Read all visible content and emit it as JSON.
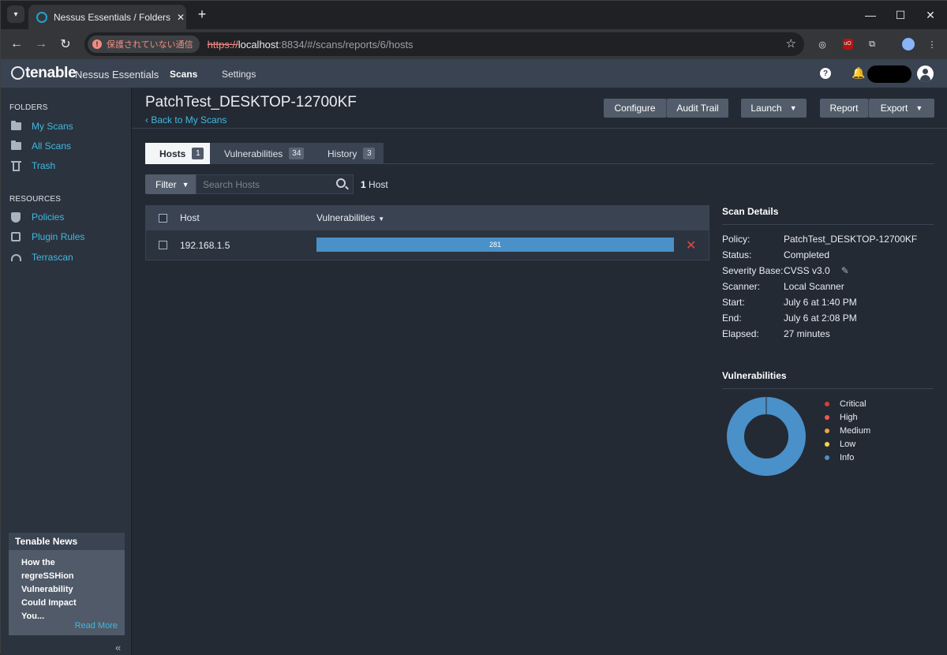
{
  "browser": {
    "tab_title": "Nessus Essentials / Folders / View Scan",
    "secure_label": "保護されていない通信",
    "url_scheme": "https://",
    "url_host": "localhost",
    "url_path": ":8834/#/scans/reports/6/hosts"
  },
  "app": {
    "logo": "tenable",
    "product": "Nessus Essentials",
    "nav_scans": "Scans",
    "nav_settings": "Settings"
  },
  "sidebar": {
    "folders_title": "FOLDERS",
    "folders": [
      {
        "label": "My Scans",
        "icon": "folder-icon"
      },
      {
        "label": "All Scans",
        "icon": "folder-icon"
      },
      {
        "label": "Trash",
        "icon": "trash-icon"
      }
    ],
    "resources_title": "RESOURCES",
    "resources": [
      {
        "label": "Policies",
        "icon": "shield-icon"
      },
      {
        "label": "Plugin Rules",
        "icon": "plugin-icon"
      },
      {
        "label": "Terrascan",
        "icon": "terrascan-icon"
      }
    ],
    "news_title": "Tenable News",
    "news_text": "How the regreSSHion Vulnerability Could Impact You...",
    "news_link": "Read More"
  },
  "main": {
    "title": "PatchTest_DESKTOP-12700KF",
    "back": "Back to My Scans",
    "buttons": {
      "configure": "Configure",
      "audit_trail": "Audit Trail",
      "launch": "Launch",
      "report": "Report",
      "export": "Export"
    },
    "tabs": [
      {
        "label": "Hosts",
        "count": "1"
      },
      {
        "label": "Vulnerabilities",
        "count": "34"
      },
      {
        "label": "History",
        "count": "3"
      }
    ],
    "filter_label": "Filter",
    "search_placeholder": "Search Hosts",
    "host_count_num": "1",
    "host_count_label": "Host",
    "table": {
      "col_host": "Host",
      "col_vulns": "Vulnerabilities",
      "rows": [
        {
          "host": "192.168.1.5",
          "vulns": "281",
          "info_fraction": 1.0
        }
      ]
    }
  },
  "scan_details": {
    "title": "Scan Details",
    "rows": [
      {
        "key": "Policy:",
        "value": "PatchTest_DESKTOP-12700KF"
      },
      {
        "key": "Status:",
        "value": "Completed"
      },
      {
        "key": "Severity Base:",
        "value": "CVSS v3.0"
      },
      {
        "key": "Scanner:",
        "value": "Local Scanner"
      },
      {
        "key": "Start:",
        "value": "July 6 at 1:40 PM"
      },
      {
        "key": "End:",
        "value": "July 6 at 2:08 PM"
      },
      {
        "key": "Elapsed:",
        "value": "27 minutes"
      }
    ]
  },
  "vulnerabilities": {
    "title": "Vulnerabilities",
    "legend": [
      {
        "label": "Critical",
        "color": "#d43f3a",
        "count": 0
      },
      {
        "label": "High",
        "color": "#ee5a52",
        "count": 0
      },
      {
        "label": "Medium",
        "color": "#f0a04b",
        "count": 0
      },
      {
        "label": "Low",
        "color": "#f7d44b",
        "count": 0
      },
      {
        "label": "Info",
        "color": "#4a90c9",
        "count": 281
      }
    ]
  }
}
